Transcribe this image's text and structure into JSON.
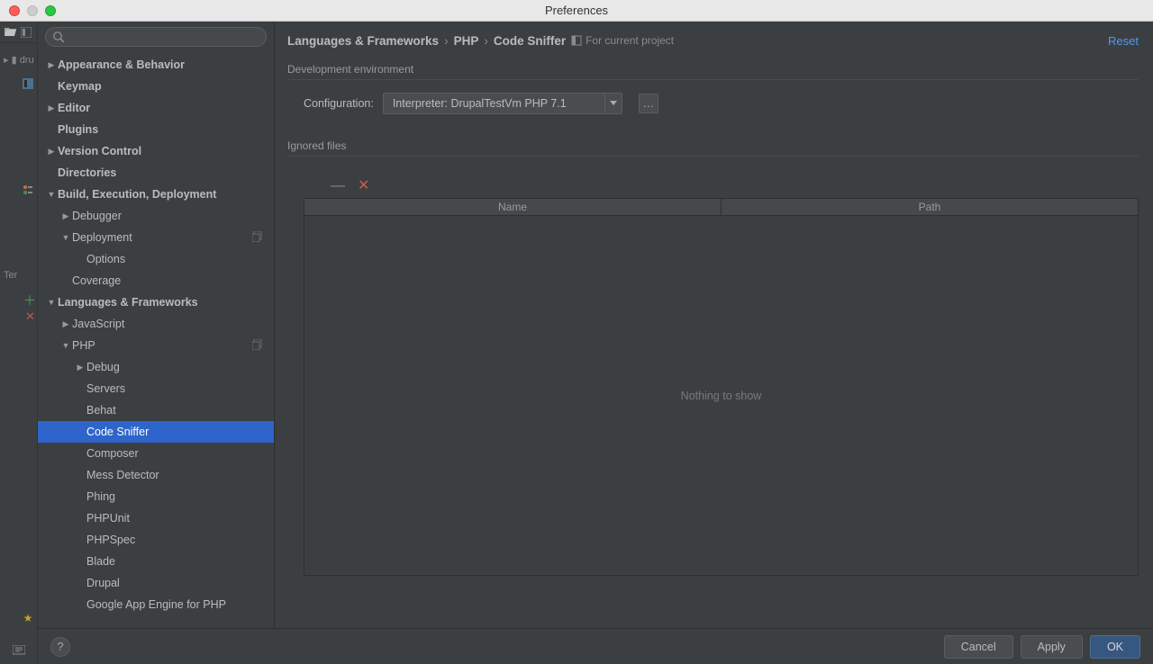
{
  "window": {
    "title": "Preferences"
  },
  "background": {
    "sideTabs": {
      "project": "1: Project",
      "structure": "7: Structure",
      "favorites": "2: Favorites"
    },
    "snips": {
      "dru": "dru",
      "ter": "Ter"
    }
  },
  "search": {
    "placeholder": ""
  },
  "sidebar": {
    "items": [
      {
        "label": "Appearance & Behavior",
        "bold": true,
        "indent": 0,
        "disclosure": "right"
      },
      {
        "label": "Keymap",
        "bold": true,
        "indent": 0,
        "disclosure": "none"
      },
      {
        "label": "Editor",
        "bold": true,
        "indent": 0,
        "disclosure": "right"
      },
      {
        "label": "Plugins",
        "bold": true,
        "indent": 0,
        "disclosure": "none"
      },
      {
        "label": "Version Control",
        "bold": true,
        "indent": 0,
        "disclosure": "right"
      },
      {
        "label": "Directories",
        "bold": true,
        "indent": 0,
        "disclosure": "none"
      },
      {
        "label": "Build, Execution, Deployment",
        "bold": true,
        "indent": 0,
        "disclosure": "down"
      },
      {
        "label": "Debugger",
        "bold": false,
        "indent": 1,
        "disclosure": "right"
      },
      {
        "label": "Deployment",
        "bold": false,
        "indent": 1,
        "disclosure": "down",
        "badge": true
      },
      {
        "label": "Options",
        "bold": false,
        "indent": 2,
        "disclosure": "none"
      },
      {
        "label": "Coverage",
        "bold": false,
        "indent": 1,
        "disclosure": "none"
      },
      {
        "label": "Languages & Frameworks",
        "bold": true,
        "indent": 0,
        "disclosure": "down"
      },
      {
        "label": "JavaScript",
        "bold": false,
        "indent": 1,
        "disclosure": "right"
      },
      {
        "label": "PHP",
        "bold": false,
        "indent": 1,
        "disclosure": "down",
        "badge": true
      },
      {
        "label": "Debug",
        "bold": false,
        "indent": 2,
        "disclosure": "right"
      },
      {
        "label": "Servers",
        "bold": false,
        "indent": 2,
        "disclosure": "none"
      },
      {
        "label": "Behat",
        "bold": false,
        "indent": 2,
        "disclosure": "none"
      },
      {
        "label": "Code Sniffer",
        "bold": false,
        "indent": 2,
        "disclosure": "none",
        "selected": true
      },
      {
        "label": "Composer",
        "bold": false,
        "indent": 2,
        "disclosure": "none"
      },
      {
        "label": "Mess Detector",
        "bold": false,
        "indent": 2,
        "disclosure": "none"
      },
      {
        "label": "Phing",
        "bold": false,
        "indent": 2,
        "disclosure": "none"
      },
      {
        "label": "PHPUnit",
        "bold": false,
        "indent": 2,
        "disclosure": "none"
      },
      {
        "label": "PHPSpec",
        "bold": false,
        "indent": 2,
        "disclosure": "none"
      },
      {
        "label": "Blade",
        "bold": false,
        "indent": 2,
        "disclosure": "none"
      },
      {
        "label": "Drupal",
        "bold": false,
        "indent": 2,
        "disclosure": "none"
      },
      {
        "label": "Google App Engine for PHP",
        "bold": false,
        "indent": 2,
        "disclosure": "none"
      }
    ]
  },
  "main": {
    "breadcrumbs": {
      "a": "Languages & Frameworks",
      "b": "PHP",
      "c": "Code Sniffer",
      "scope": "For current project"
    },
    "reset": "Reset",
    "section_dev": "Development environment",
    "config_label": "Configuration:",
    "config_value": "Interpreter: DrupalTestVm PHP 7.1",
    "section_ignored": "Ignored files",
    "table": {
      "col_name": "Name",
      "col_path": "Path",
      "empty": "Nothing to show"
    }
  },
  "footer": {
    "help": "?",
    "cancel": "Cancel",
    "apply": "Apply",
    "ok": "OK"
  }
}
